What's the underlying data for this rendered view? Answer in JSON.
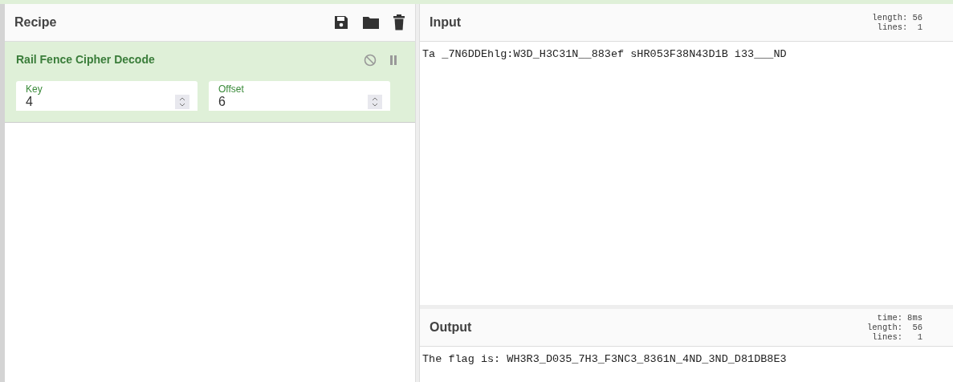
{
  "recipe": {
    "title": "Recipe",
    "operations": [
      {
        "name": "Rail Fence Cipher Decode",
        "disabled": false,
        "breakpoint": false,
        "args": [
          {
            "label": "Key",
            "value": "4"
          },
          {
            "label": "Offset",
            "value": "6"
          }
        ]
      }
    ]
  },
  "input": {
    "title": "Input",
    "stats": [
      {
        "label": "length:",
        "value": "56"
      },
      {
        "label": "lines:",
        "value": "1"
      }
    ],
    "text": "Ta _7N6DDEhlg:W3D_H3C31N__883ef sHR053F38N43D1B i33___ND"
  },
  "output": {
    "title": "Output",
    "stats": [
      {
        "label": "time:",
        "value": "8ms"
      },
      {
        "label": "length:",
        "value": "56"
      },
      {
        "label": "lines:",
        "value": "1"
      }
    ],
    "text": "The flag is: WH3R3_D035_7H3_F3NC3_8361N_4ND_3ND_D81DB8E3"
  }
}
